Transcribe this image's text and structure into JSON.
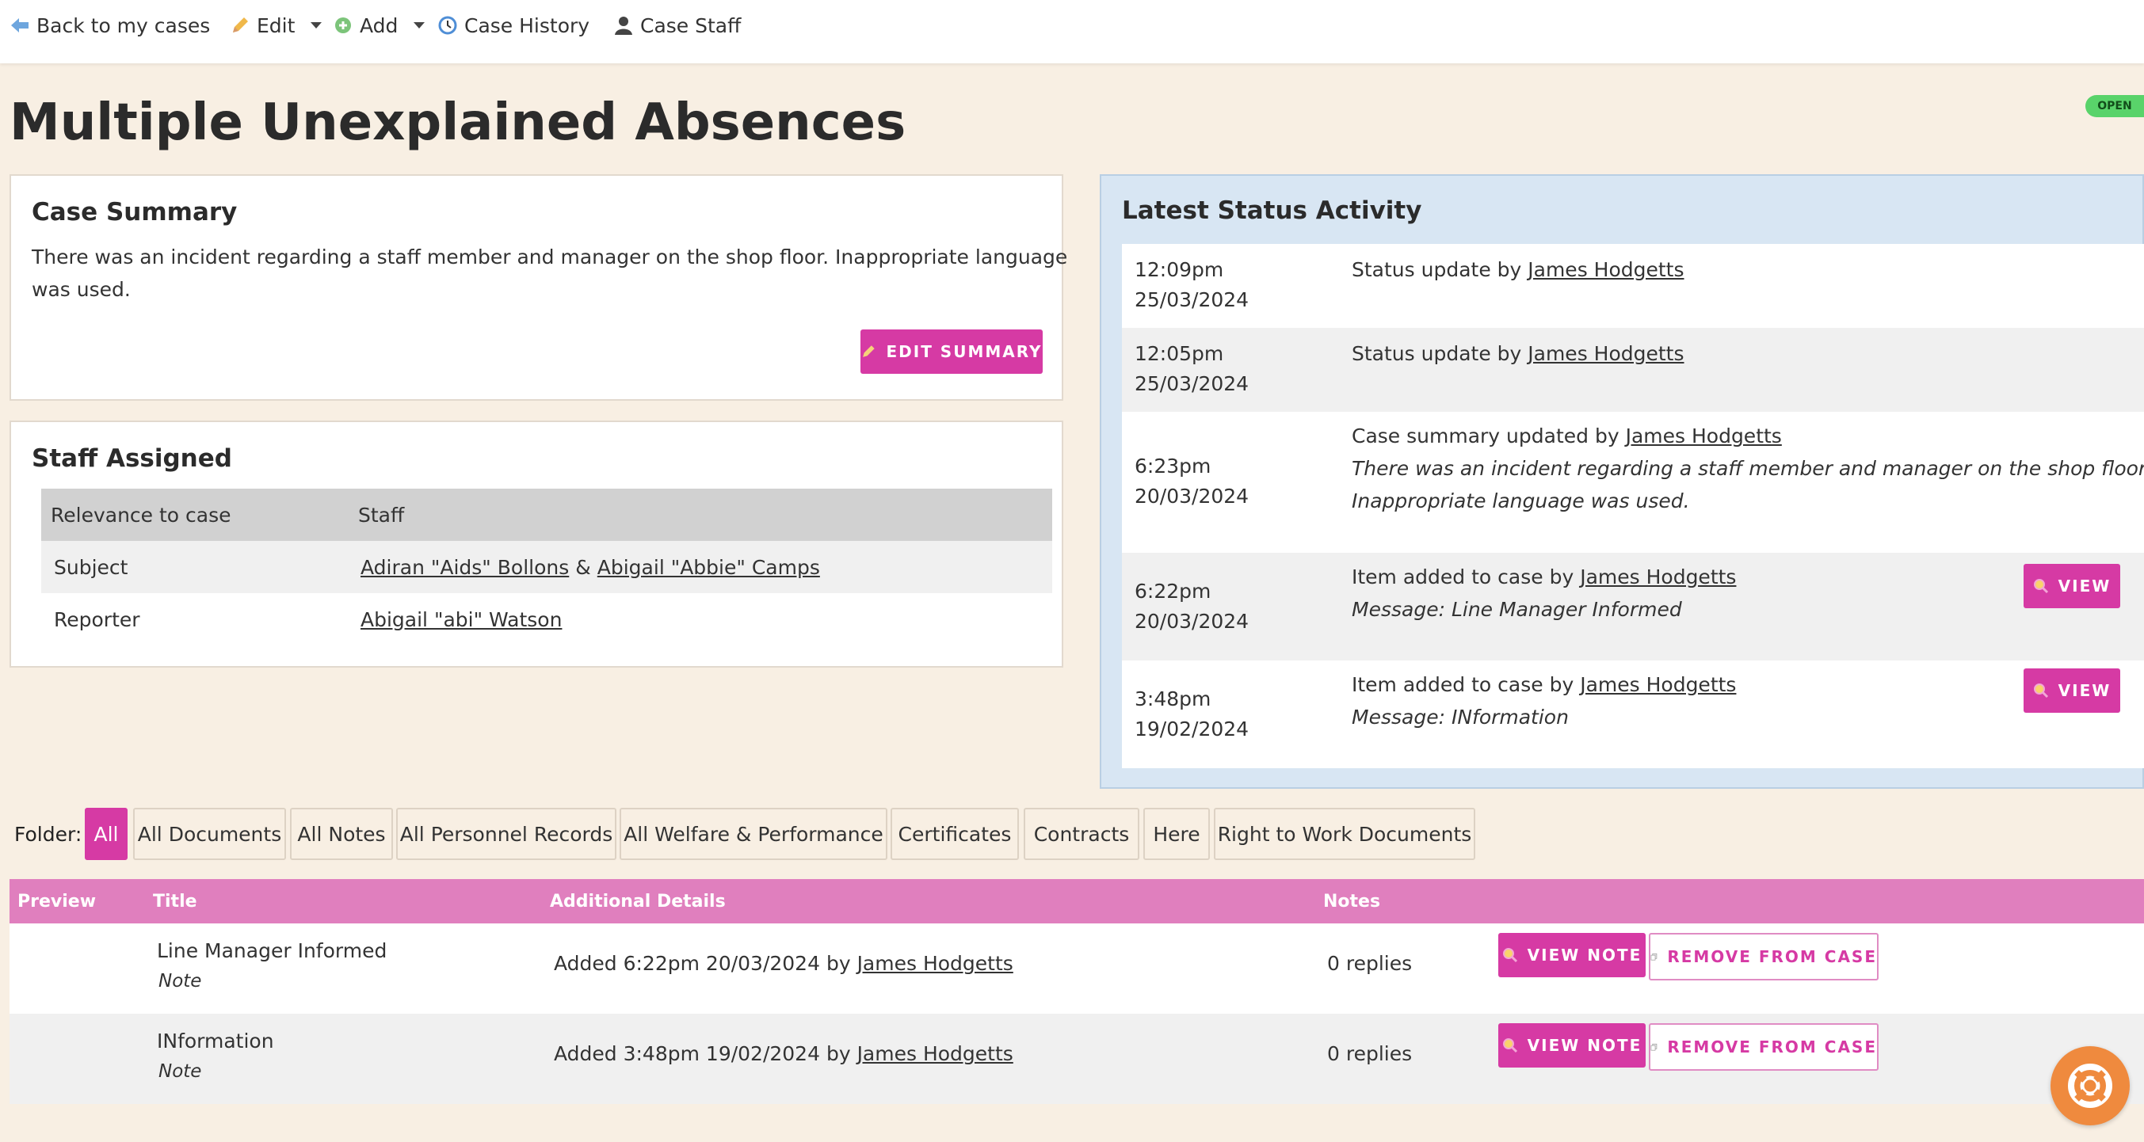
{
  "toolbar": {
    "back_label": "Back to my cases",
    "edit_label": "Edit",
    "add_label": "Add",
    "history_label": "Case History",
    "staff_label": "Case Staff"
  },
  "page": {
    "title": "Multiple Unexplained Absences",
    "status_badge": "OPEN"
  },
  "summary": {
    "heading": "Case Summary",
    "text_line1": "There was an incident regarding a staff member and manager on the shop floor. Inappropriate language",
    "text_line2": "was used.",
    "edit_button": "EDIT SUMMARY"
  },
  "staff": {
    "heading": "Staff Assigned",
    "columns": [
      "Relevance to case",
      "Staff"
    ],
    "rows": [
      {
        "relevance": "Subject",
        "staff1": "Adiran \"Aids\" Bollons",
        "separator": "&",
        "staff2": "Abigail \"Abbie\" Camps"
      },
      {
        "relevance": "Reporter",
        "staff1": "Abigail \"abi\" Watson"
      }
    ]
  },
  "activity": {
    "heading": "Latest Status Activity",
    "items": [
      {
        "time": "12:09pm",
        "date": "25/03/2024",
        "text": "Status update by",
        "user": "James Hodgetts"
      },
      {
        "time": "12:05pm",
        "date": "25/03/2024",
        "text": "Status update by",
        "user": "James Hodgetts"
      },
      {
        "time": "6:23pm",
        "date": "20/03/2024",
        "text": "Case summary updated by",
        "user": "James Hodgetts",
        "detail1": "There was an incident regarding a staff member and manager on the shop floor.",
        "detail2": "Inappropriate language was used."
      },
      {
        "time": "6:22pm",
        "date": "20/03/2024",
        "text": "Item added to case by",
        "user": "James Hodgetts",
        "detail1": "Message: Line Manager Informed",
        "button": "VIEW"
      },
      {
        "time": "3:48pm",
        "date": "19/02/2024",
        "text": "Item added to case by",
        "user": "James Hodgetts",
        "detail1": "Message: INformation",
        "button": "VIEW"
      }
    ]
  },
  "folders": {
    "label": "Folder:",
    "tabs": [
      "All",
      "All Documents",
      "All Notes",
      "All Personnel Records",
      "All Welfare & Performance",
      "Certificates",
      "Contracts",
      "Here",
      "Right to Work Documents"
    ],
    "active": "All"
  },
  "files": {
    "columns": [
      "Preview",
      "Title",
      "Additional Details",
      "Notes"
    ],
    "rows": [
      {
        "title": "Line Manager Informed",
        "type": "Note",
        "details": "Added 6:22pm 20/03/2024 by",
        "user": "James Hodgetts",
        "notes": "0 replies",
        "view_btn": "VIEW NOTE",
        "remove_btn": "REMOVE FROM CASE"
      },
      {
        "title": "INformation",
        "type": "Note",
        "details": "Added 3:48pm 19/02/2024 by",
        "user": "James Hodgetts",
        "notes": "0 replies",
        "view_btn": "VIEW NOTE",
        "remove_btn": "REMOVE FROM CASE"
      }
    ]
  },
  "colors": {
    "accent": "#d63aa4",
    "page_bg": "#f8efe3",
    "activity_bg": "#d8e6f3",
    "table_header": "#e07fbe",
    "open_badge": "#59d36a",
    "support": "#ef8a3e"
  },
  "icons": {
    "back": "arrow-left-icon",
    "edit": "pencil-icon",
    "add": "plus-circle-icon",
    "history": "clock-icon",
    "staff": "person-icon",
    "view": "magnifier-icon",
    "remove": "copy-icon",
    "support": "lifebuoy-icon"
  }
}
